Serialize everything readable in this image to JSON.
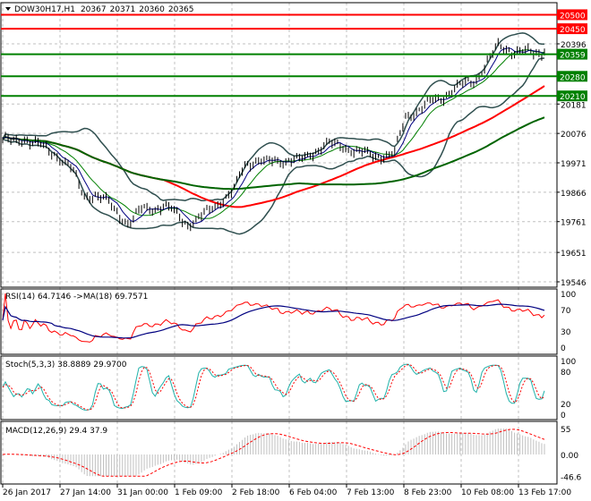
{
  "chart_data": [
    {
      "type": "line",
      "panel": "price",
      "title": "DOW30H17,H1",
      "ohlc": [
        "20367",
        "20371",
        "20360",
        "20365"
      ],
      "ylim": [
        19546,
        20500
      ],
      "y_ticks": [
        "20396",
        "20181",
        "20076",
        "19971",
        "19866",
        "19761",
        "19651",
        "19546"
      ],
      "y_tick_values": [
        20396,
        20181,
        20076,
        19971,
        19866,
        19761,
        19651,
        19546
      ],
      "close": [
        20057,
        20041,
        20060,
        20041,
        20010,
        19993,
        19950,
        19850,
        19860,
        19834,
        19790,
        19754,
        19802,
        19810,
        19818,
        19790,
        19754,
        19770,
        19802,
        19840,
        19866,
        19962,
        19984,
        19970,
        19978,
        19985,
        19978,
        20010,
        20041,
        20030,
        20025,
        20010,
        19993,
        20000,
        20003,
        20137,
        20160,
        20185,
        20200,
        20233,
        20250,
        20265,
        20329,
        20386,
        20375,
        20367,
        20361,
        20365
      ],
      "levels": [
        {
          "value": "20500",
          "color": "#ff0000"
        },
        {
          "value": "20450",
          "color": "#ff0000"
        },
        {
          "value": "20359",
          "color": "#008000"
        },
        {
          "value": "20280",
          "color": "#008000"
        },
        {
          "value": "20210",
          "color": "#008000"
        }
      ],
      "overlays": [
        "Bollinger Bands",
        "moving averages"
      ],
      "colors": {
        "bands": "#2f4f4f",
        "ma_slow_red": "#ff0000",
        "ma_slower_green": "#006400",
        "ma_fast": "#008000",
        "price": "#000000"
      }
    },
    {
      "type": "line",
      "panel": "rsi",
      "title": "RSI(14) 64.7146  ->MA(18) 69.7571",
      "ylim": [
        0,
        100
      ],
      "y_ticks": [
        "100",
        "70",
        "30",
        "0"
      ],
      "colors": {
        "rsi": "#ff0000",
        "ma": "#000080"
      }
    },
    {
      "type": "line",
      "panel": "stoch",
      "title": "Stoch(5,3,3) 38.8889 29.9700",
      "ylim": [
        0,
        100
      ],
      "y_ticks": [
        "100",
        "80",
        "20",
        "0"
      ],
      "colors": {
        "main": "#20b2aa",
        "signal": "#ff0000"
      }
    },
    {
      "type": "bar",
      "panel": "macd",
      "title": "MACD(12,26,9) 29.4 37.9",
      "ylim": [
        -46.6,
        55
      ],
      "y_ticks": [
        "55",
        "0.00",
        "-46.6"
      ],
      "colors": {
        "histogram": "#c0c0c0",
        "signal": "#ff0000"
      }
    }
  ],
  "x_axis": {
    "tick_labels": [
      "26 Jan 2017",
      "27 Jan 14:00",
      "31 Jan 00:00",
      "1 Feb 09:00",
      "2 Feb 18:00",
      "6 Feb 04:00",
      "7 Feb 13:00",
      "8 Feb 23:00",
      "10 Feb 08:00",
      "13 Feb 17:00"
    ]
  },
  "grid": true
}
